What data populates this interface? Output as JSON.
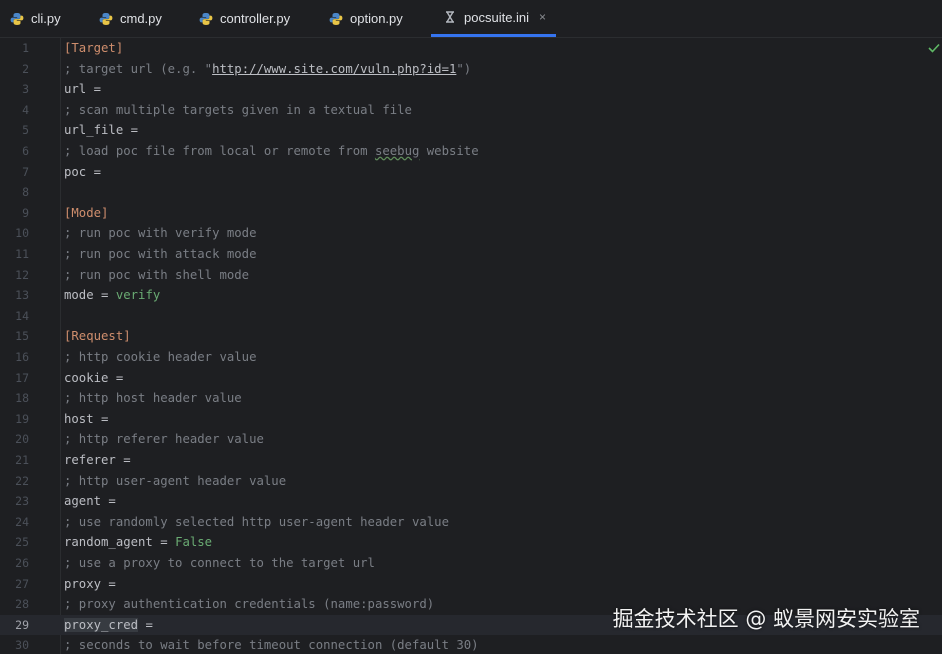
{
  "tabs": [
    {
      "label": "cli.py",
      "icon": "python-file-icon"
    },
    {
      "label": "cmd.py",
      "icon": "python-file-icon"
    },
    {
      "label": "controller.py",
      "icon": "python-file-icon"
    },
    {
      "label": "option.py",
      "icon": "python-file-icon"
    },
    {
      "label": "pocsuite.ini",
      "icon": "ini-file-icon",
      "active": true,
      "close": "×"
    }
  ],
  "editor": {
    "current_line": 29,
    "lines": [
      {
        "n": "1",
        "parts": [
          {
            "t": "[Target]",
            "c": "section"
          }
        ]
      },
      {
        "n": "2",
        "parts": [
          {
            "t": "; target url (e.g. \"",
            "c": "comment"
          },
          {
            "t": "http://www.site.com/vuln.php?id=1",
            "c": "link"
          },
          {
            "t": "\")",
            "c": "comment"
          }
        ]
      },
      {
        "n": "3",
        "parts": [
          {
            "t": "url =",
            "c": "key"
          }
        ]
      },
      {
        "n": "4",
        "parts": [
          {
            "t": "; scan multiple targets given in a textual file",
            "c": "comment"
          }
        ]
      },
      {
        "n": "5",
        "parts": [
          {
            "t": "url_file =",
            "c": "key"
          }
        ]
      },
      {
        "n": "6",
        "parts": [
          {
            "t": "; load poc file from local or remote from ",
            "c": "comment"
          },
          {
            "t": "seebug",
            "c": "comment typo"
          },
          {
            "t": " website",
            "c": "comment"
          }
        ]
      },
      {
        "n": "7",
        "parts": [
          {
            "t": "poc =",
            "c": "key"
          }
        ]
      },
      {
        "n": "8",
        "parts": []
      },
      {
        "n": "9",
        "parts": [
          {
            "t": "[Mode]",
            "c": "section"
          }
        ]
      },
      {
        "n": "10",
        "parts": [
          {
            "t": "; run poc with verify mode",
            "c": "comment"
          }
        ]
      },
      {
        "n": "11",
        "parts": [
          {
            "t": "; run poc with attack mode",
            "c": "comment"
          }
        ]
      },
      {
        "n": "12",
        "parts": [
          {
            "t": "; run poc with shell mode",
            "c": "comment"
          }
        ]
      },
      {
        "n": "13",
        "parts": [
          {
            "t": "mode = ",
            "c": "key"
          },
          {
            "t": "verify",
            "c": "val"
          }
        ]
      },
      {
        "n": "14",
        "parts": []
      },
      {
        "n": "15",
        "parts": [
          {
            "t": "[Request]",
            "c": "section"
          }
        ]
      },
      {
        "n": "16",
        "parts": [
          {
            "t": "; http cookie header value",
            "c": "comment"
          }
        ]
      },
      {
        "n": "17",
        "parts": [
          {
            "t": "cookie =",
            "c": "key"
          }
        ]
      },
      {
        "n": "18",
        "parts": [
          {
            "t": "; http host header value",
            "c": "comment"
          }
        ]
      },
      {
        "n": "19",
        "parts": [
          {
            "t": "host =",
            "c": "key"
          }
        ]
      },
      {
        "n": "20",
        "parts": [
          {
            "t": "; http referer header value",
            "c": "comment"
          }
        ]
      },
      {
        "n": "21",
        "parts": [
          {
            "t": "referer =",
            "c": "key"
          }
        ]
      },
      {
        "n": "22",
        "parts": [
          {
            "t": "; http user-agent header value",
            "c": "comment"
          }
        ]
      },
      {
        "n": "23",
        "parts": [
          {
            "t": "agent =",
            "c": "key"
          }
        ]
      },
      {
        "n": "24",
        "parts": [
          {
            "t": "; use randomly selected http user-agent header value",
            "c": "comment"
          }
        ]
      },
      {
        "n": "25",
        "parts": [
          {
            "t": "random_agent = ",
            "c": "key"
          },
          {
            "t": "False",
            "c": "val"
          }
        ]
      },
      {
        "n": "26",
        "parts": [
          {
            "t": "; use a proxy to connect to the target url",
            "c": "comment"
          }
        ]
      },
      {
        "n": "27",
        "parts": [
          {
            "t": "proxy =",
            "c": "key"
          }
        ]
      },
      {
        "n": "28",
        "parts": [
          {
            "t": "; proxy authentication credentials (name:password)",
            "c": "comment"
          }
        ]
      },
      {
        "n": "29",
        "parts": [
          {
            "t": "proxy_cred",
            "c": "key hl"
          },
          {
            "t": " =",
            "c": "key"
          }
        ]
      },
      {
        "n": "30",
        "parts": [
          {
            "t": "; seconds to wait before timeout connection (default 30)",
            "c": "comment"
          }
        ]
      }
    ]
  },
  "status_icon": "checkmark-icon",
  "watermark": "掘金技术社区 @ 蚁景网安实验室",
  "colors": {
    "background": "#1e1f22",
    "section": "#cf8e6d",
    "comment": "#7a7e85",
    "value": "#6aab73",
    "accent": "#3574f0"
  }
}
